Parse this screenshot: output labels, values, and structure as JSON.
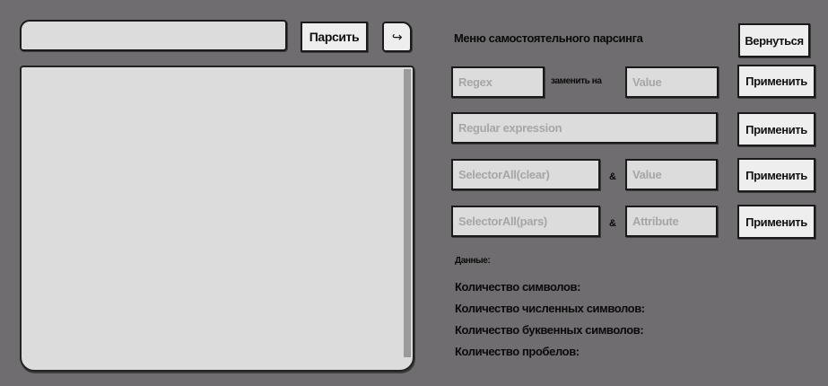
{
  "url_input": {
    "value": "",
    "placeholder": ""
  },
  "parse_button": "Парсить",
  "redo_icon": "↪",
  "output_area": {
    "value": ""
  },
  "menu_title": "Меню самостоятельного парсинга",
  "back_button": "Вернуться",
  "replace_row": {
    "regex_placeholder": "Regex",
    "connector": "заменить на",
    "value_placeholder": "Value",
    "apply_button": "Применить"
  },
  "regexp_row": {
    "placeholder": "Regular expression",
    "apply_button": "Применить"
  },
  "clear_row": {
    "selector_placeholder": "SelectorAll(clear)",
    "connector": "&",
    "value_placeholder": "Value",
    "apply_button": "Применить"
  },
  "pars_row": {
    "selector_placeholder": "SelectorAll(pars)",
    "connector": "&",
    "attribute_placeholder": "Attribute",
    "apply_button": "Применить"
  },
  "stats": {
    "heading": "Данные:",
    "char_count": "Количество символов:",
    "digit_count": "Количество численных символов:",
    "letter_count": "Количество буквенных символов:",
    "space_count": "Количество пробелов:"
  }
}
